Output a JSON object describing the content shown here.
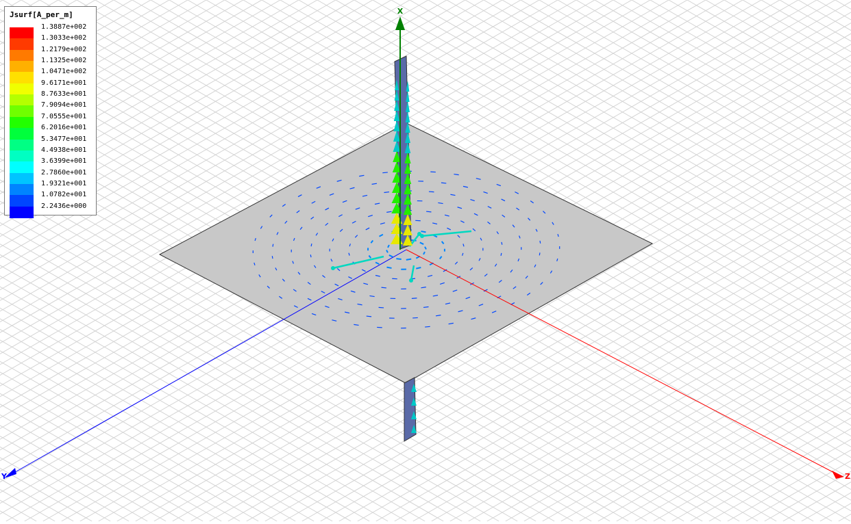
{
  "legend": {
    "title": "Jsurf[A_per_m]",
    "entries": [
      {
        "value": "1.3887e+002",
        "color": "#ff0000"
      },
      {
        "value": "1.3033e+002",
        "color": "#ff3a00"
      },
      {
        "value": "1.2179e+002",
        "color": "#ff7a00"
      },
      {
        "value": "1.1325e+002",
        "color": "#ffb000"
      },
      {
        "value": "1.0471e+002",
        "color": "#ffe000"
      },
      {
        "value": "9.6171e+001",
        "color": "#f0ff00"
      },
      {
        "value": "8.7633e+001",
        "color": "#b4ff00"
      },
      {
        "value": "7.9094e+001",
        "color": "#6fff00"
      },
      {
        "value": "7.0555e+001",
        "color": "#22ff00"
      },
      {
        "value": "6.2016e+001",
        "color": "#00ff3c"
      },
      {
        "value": "5.3477e+001",
        "color": "#00ff84"
      },
      {
        "value": "4.4938e+001",
        "color": "#00ffc2"
      },
      {
        "value": "3.6399e+001",
        "color": "#00ffff"
      },
      {
        "value": "2.7860e+001",
        "color": "#00c4ff"
      },
      {
        "value": "1.9321e+001",
        "color": "#0084ff"
      },
      {
        "value": "1.0782e+001",
        "color": "#0046ff"
      },
      {
        "value": "2.2436e+000",
        "color": "#0000ff"
      }
    ]
  },
  "axes": {
    "x_label": "X",
    "y_label": "Y",
    "z_label": "Z",
    "x_color": "#008000",
    "y_color": "#0000ff",
    "z_color": "#ff0000"
  },
  "model": {
    "plane_color": "#c8c8c8",
    "strip_color": "#5a6aa8",
    "grid_color": "#d4d4d4"
  }
}
